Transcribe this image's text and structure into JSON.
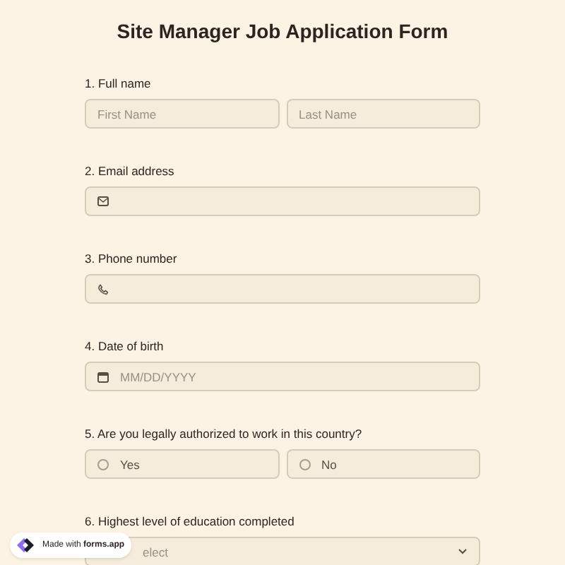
{
  "title": "Site Manager Job Application Form",
  "questions": [
    {
      "kind": "name",
      "number": "1.",
      "label": "Full name",
      "fields": [
        {
          "placeholder": "First Name"
        },
        {
          "placeholder": "Last Name"
        }
      ]
    },
    {
      "kind": "email",
      "number": "2.",
      "label": "Email address"
    },
    {
      "kind": "phone",
      "number": "3.",
      "label": "Phone number"
    },
    {
      "kind": "date",
      "number": "4.",
      "label": "Date of birth",
      "placeholder": "MM/DD/YYYY"
    },
    {
      "kind": "radio",
      "number": "5.",
      "label": "Are you legally authorized to work in this country?",
      "options": [
        {
          "label": "Yes",
          "selected": false
        },
        {
          "label": "No",
          "selected": false
        }
      ]
    },
    {
      "kind": "select",
      "number": "6.",
      "label": "Highest level of education completed",
      "placeholder": "elect"
    }
  ],
  "badge": {
    "text": "Made with **forms.app**"
  }
}
